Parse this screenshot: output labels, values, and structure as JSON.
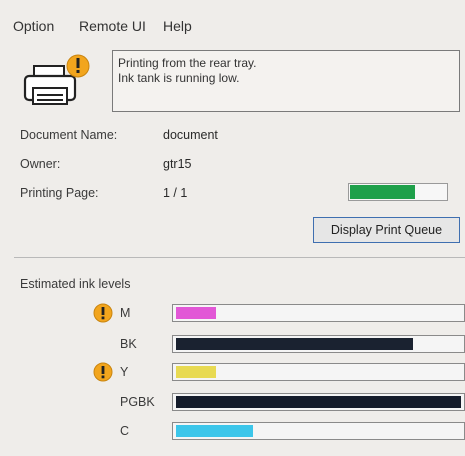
{
  "menu": {
    "items": [
      "Option",
      "Remote UI",
      "Help"
    ]
  },
  "status": {
    "icon": "printer-warning-icon",
    "lines": [
      "Printing from the rear tray.",
      "Ink tank is running low."
    ]
  },
  "job": {
    "document_name_label": "Document Name:",
    "document_name": "document",
    "owner_label": "Owner:",
    "owner": "gtr15",
    "printing_page_label": "Printing Page:",
    "printing_page": "1 / 1",
    "progress_fraction": 0.68,
    "progress_color": "#1ea04a"
  },
  "display_queue_button": "Display Print Queue",
  "ink": {
    "title": "Estimated ink levels",
    "tanks": [
      {
        "name": "M",
        "warning": true,
        "level": 0.14,
        "color": "#e257d6"
      },
      {
        "name": "BK",
        "warning": false,
        "level": 0.83,
        "color": "#1a2230"
      },
      {
        "name": "Y",
        "warning": true,
        "level": 0.14,
        "color": "#e8da52"
      },
      {
        "name": "PGBK",
        "warning": false,
        "level": 1.0,
        "color": "#151c2b"
      },
      {
        "name": "C",
        "warning": false,
        "level": 0.27,
        "color": "#3cc6ea"
      }
    ]
  }
}
